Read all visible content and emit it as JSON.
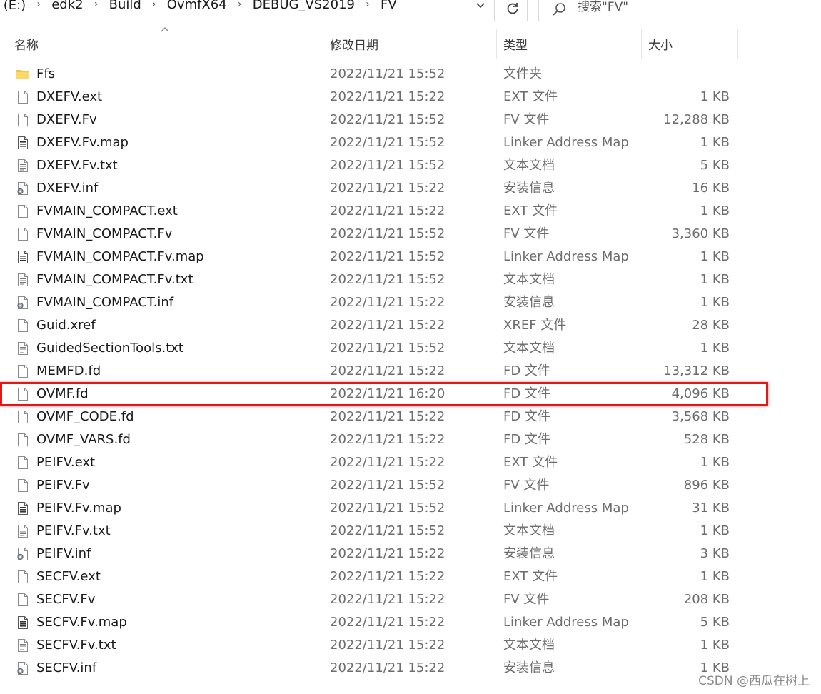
{
  "address_bar": {
    "crumbs": [
      "卷 (E:)",
      "edk2",
      "Build",
      "OvmfX64",
      "DEBUG_VS2019",
      "FV"
    ]
  },
  "search": {
    "placeholder": "搜索\"FV\""
  },
  "columns": {
    "name": "名称",
    "date": "修改日期",
    "type": "类型",
    "size": "大小"
  },
  "files": [
    {
      "name": "Ffs",
      "date": "2022/11/21 15:52",
      "type": "文件夹",
      "size": "",
      "icon": "folder-icon"
    },
    {
      "name": "DXEFV.ext",
      "date": "2022/11/21 15:22",
      "type": "EXT 文件",
      "size": "1 KB",
      "icon": "file-icon"
    },
    {
      "name": "DXEFV.Fv",
      "date": "2022/11/21 15:52",
      "type": "FV 文件",
      "size": "12,288 KB",
      "icon": "file-icon"
    },
    {
      "name": "DXEFV.Fv.map",
      "date": "2022/11/21 15:52",
      "type": "Linker Address Map",
      "size": "1 KB",
      "icon": "map-file-icon"
    },
    {
      "name": "DXEFV.Fv.txt",
      "date": "2022/11/21 15:52",
      "type": "文本文档",
      "size": "5 KB",
      "icon": "text-file-icon"
    },
    {
      "name": "DXEFV.inf",
      "date": "2022/11/21 15:22",
      "type": "安装信息",
      "size": "16 KB",
      "icon": "inf-file-icon"
    },
    {
      "name": "FVMAIN_COMPACT.ext",
      "date": "2022/11/21 15:22",
      "type": "EXT 文件",
      "size": "1 KB",
      "icon": "file-icon"
    },
    {
      "name": "FVMAIN_COMPACT.Fv",
      "date": "2022/11/21 15:52",
      "type": "FV 文件",
      "size": "3,360 KB",
      "icon": "file-icon"
    },
    {
      "name": "FVMAIN_COMPACT.Fv.map",
      "date": "2022/11/21 15:52",
      "type": "Linker Address Map",
      "size": "1 KB",
      "icon": "map-file-icon"
    },
    {
      "name": "FVMAIN_COMPACT.Fv.txt",
      "date": "2022/11/21 15:52",
      "type": "文本文档",
      "size": "1 KB",
      "icon": "text-file-icon"
    },
    {
      "name": "FVMAIN_COMPACT.inf",
      "date": "2022/11/21 15:22",
      "type": "安装信息",
      "size": "1 KB",
      "icon": "inf-file-icon"
    },
    {
      "name": "Guid.xref",
      "date": "2022/11/21 15:22",
      "type": "XREF 文件",
      "size": "28 KB",
      "icon": "file-icon"
    },
    {
      "name": "GuidedSectionTools.txt",
      "date": "2022/11/21 15:52",
      "type": "文本文档",
      "size": "1 KB",
      "icon": "text-file-icon"
    },
    {
      "name": "MEMFD.fd",
      "date": "2022/11/21 15:22",
      "type": "FD 文件",
      "size": "13,312 KB",
      "icon": "file-icon"
    },
    {
      "name": "OVMF.fd",
      "date": "2022/11/21 16:20",
      "type": "FD 文件",
      "size": "4,096 KB",
      "icon": "file-icon",
      "highlighted": true
    },
    {
      "name": "OVMF_CODE.fd",
      "date": "2022/11/21 15:22",
      "type": "FD 文件",
      "size": "3,568 KB",
      "icon": "file-icon"
    },
    {
      "name": "OVMF_VARS.fd",
      "date": "2022/11/21 15:22",
      "type": "FD 文件",
      "size": "528 KB",
      "icon": "file-icon"
    },
    {
      "name": "PEIFV.ext",
      "date": "2022/11/21 15:22",
      "type": "EXT 文件",
      "size": "1 KB",
      "icon": "file-icon"
    },
    {
      "name": "PEIFV.Fv",
      "date": "2022/11/21 15:52",
      "type": "FV 文件",
      "size": "896 KB",
      "icon": "file-icon"
    },
    {
      "name": "PEIFV.Fv.map",
      "date": "2022/11/21 15:52",
      "type": "Linker Address Map",
      "size": "31 KB",
      "icon": "map-file-icon"
    },
    {
      "name": "PEIFV.Fv.txt",
      "date": "2022/11/21 15:52",
      "type": "文本文档",
      "size": "1 KB",
      "icon": "text-file-icon"
    },
    {
      "name": "PEIFV.inf",
      "date": "2022/11/21 15:22",
      "type": "安装信息",
      "size": "3 KB",
      "icon": "inf-file-icon"
    },
    {
      "name": "SECFV.ext",
      "date": "2022/11/21 15:22",
      "type": "EXT 文件",
      "size": "1 KB",
      "icon": "file-icon"
    },
    {
      "name": "SECFV.Fv",
      "date": "2022/11/21 15:22",
      "type": "FV 文件",
      "size": "208 KB",
      "icon": "file-icon"
    },
    {
      "name": "SECFV.Fv.map",
      "date": "2022/11/21 15:22",
      "type": "Linker Address Map",
      "size": "5 KB",
      "icon": "map-file-icon"
    },
    {
      "name": "SECFV.Fv.txt",
      "date": "2022/11/21 15:22",
      "type": "文本文档",
      "size": "1 KB",
      "icon": "text-file-icon"
    },
    {
      "name": "SECFV.inf",
      "date": "2022/11/21 15:22",
      "type": "安装信息",
      "size": "1 KB",
      "icon": "inf-file-icon"
    }
  ],
  "highlight_color": "#e01818",
  "watermark": "CSDN @西瓜在树上"
}
